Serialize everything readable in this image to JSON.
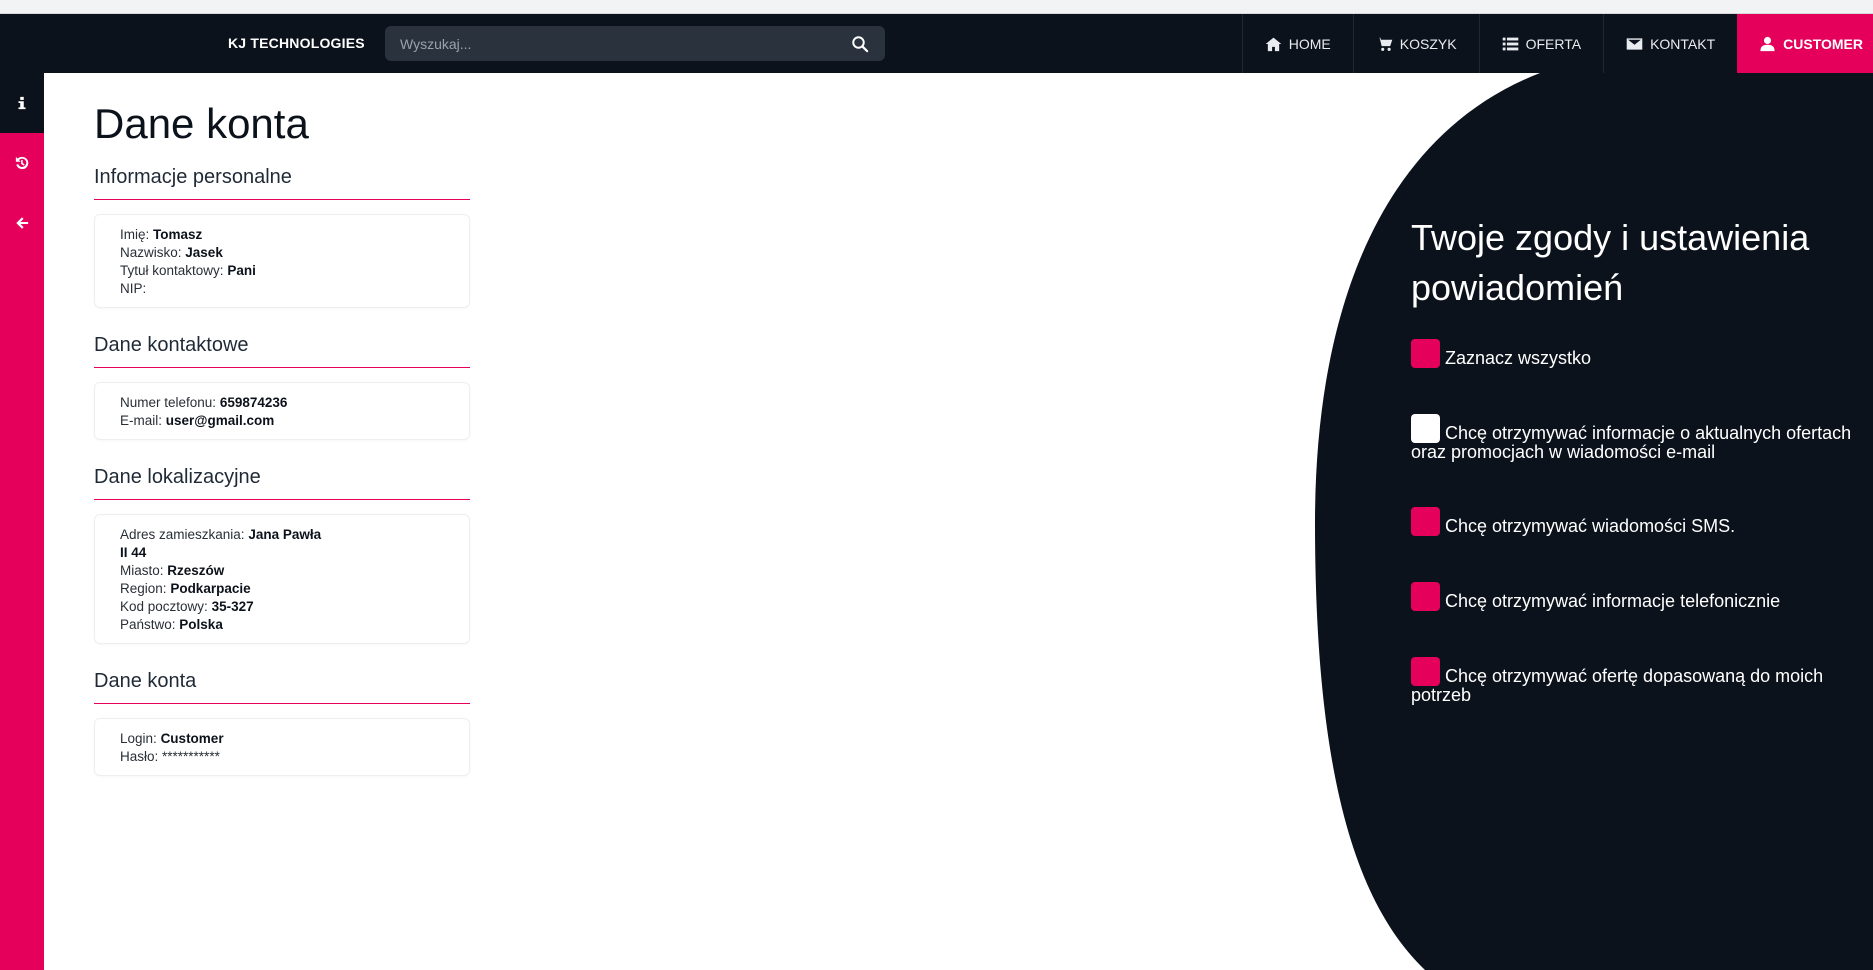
{
  "brand": "KJ TECHNOLOGIES",
  "search": {
    "placeholder": "Wyszukaj..."
  },
  "nav": {
    "home": "HOME",
    "cart": "KOSZYK",
    "offer": "OFERTA",
    "contact": "KONTAKT",
    "customer": "CUSTOMER"
  },
  "page_title": "Dane konta",
  "personal": {
    "title": "Informacje personalne",
    "first_name_label": "Imię:",
    "first_name": "Tomasz",
    "last_name_label": "Nazwisko:",
    "last_name": "Jasek",
    "salutation_label": "Tytuł kontaktowy:",
    "salutation": "Pani",
    "nip_label": "NIP:",
    "nip": ""
  },
  "contact_info": {
    "title": "Dane kontaktowe",
    "phone_label": "Numer telefonu:",
    "phone": "659874236",
    "email_label": "E-mail:",
    "email": "user@gmail.com"
  },
  "location": {
    "title": "Dane lokalizacyjne",
    "address_label": "Adres zamieszkania:",
    "address_line1": "Jana Pawła",
    "address_line2": "II 44",
    "city_label": "Miasto:",
    "city": "Rzeszów",
    "region_label": "Region:",
    "region": "Podkarpacie",
    "postal_label": "Kod pocztowy:",
    "postal": "35-327",
    "country_label": "Państwo:",
    "country": "Polska"
  },
  "account": {
    "title": "Dane konta",
    "login_label": "Login:",
    "login": "Customer",
    "password_label": "Hasło:",
    "password": "***********"
  },
  "consents": {
    "title": "Twoje zgody i ustawienia powiadomień",
    "items": [
      {
        "label": "Zaznacz wszystko",
        "checked": true
      },
      {
        "label": "Chcę otrzymywać informacje o aktualnych ofertach oraz promocjach w wiadomości e-mail",
        "checked": false
      },
      {
        "label": "Chcę otrzymywać wiadomości SMS.",
        "checked": true
      },
      {
        "label": "Chcę otrzymywać informacje telefonicznie",
        "checked": true
      },
      {
        "label": "Chcę otrzymywać ofertę dopasowaną do moich potrzeb",
        "checked": true
      }
    ]
  },
  "colors": {
    "accent": "#e5005b",
    "dark": "#0c121b",
    "search_bg": "#2a323e"
  },
  "icons": {
    "sidebar": [
      "info-icon",
      "history-icon",
      "arrow-left-icon"
    ],
    "nav": [
      "home-icon",
      "cart-icon",
      "list-icon",
      "envelope-icon",
      "user-icon"
    ]
  }
}
